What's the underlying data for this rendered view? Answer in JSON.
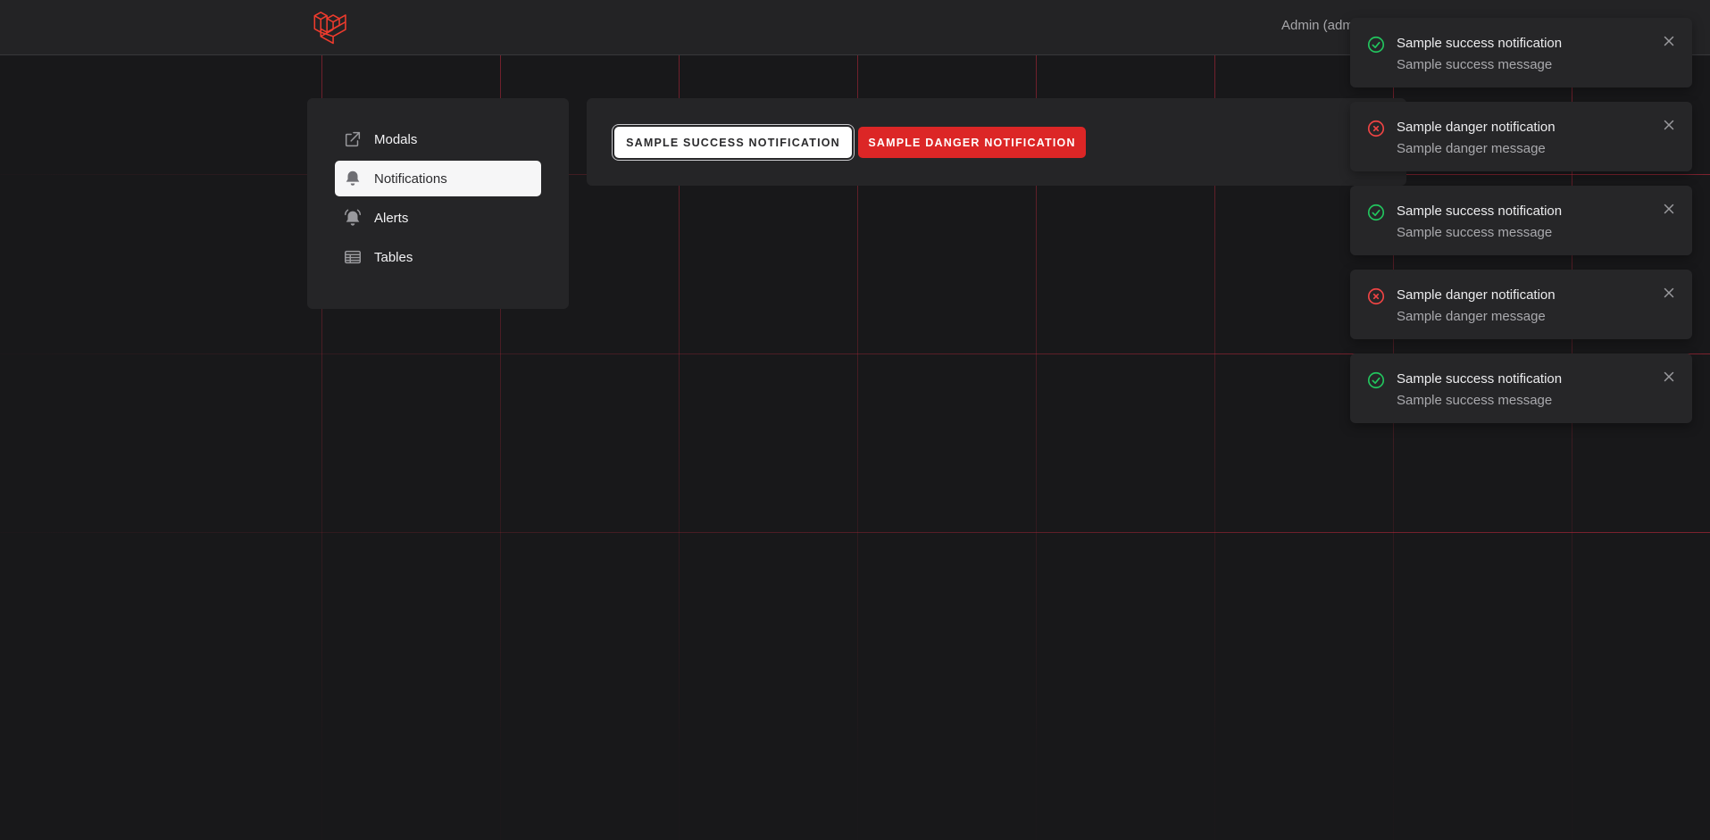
{
  "header": {
    "logo_icon": "laravel-logo-icon",
    "user_label": "Admin (admin@example.com)"
  },
  "sidebar": {
    "items": [
      {
        "label": "Modals",
        "icon": "external-link-icon",
        "active": false
      },
      {
        "label": "Notifications",
        "icon": "bell-icon",
        "active": true
      },
      {
        "label": "Alerts",
        "icon": "bell-alert-icon",
        "active": false
      },
      {
        "label": "Tables",
        "icon": "table-icon",
        "active": false
      }
    ]
  },
  "main": {
    "success_button_label": "SAMPLE SUCCESS NOTIFICATION",
    "danger_button_label": "SAMPLE DANGER NOTIFICATION"
  },
  "toasts": [
    {
      "type": "success",
      "title": "Sample success notification",
      "message": "Sample success message"
    },
    {
      "type": "danger",
      "title": "Sample danger notification",
      "message": "Sample danger message"
    },
    {
      "type": "success",
      "title": "Sample success notification",
      "message": "Sample success message"
    },
    {
      "type": "danger",
      "title": "Sample danger notification",
      "message": "Sample danger message"
    },
    {
      "type": "success",
      "title": "Sample success notification",
      "message": "Sample success message"
    }
  ],
  "colors": {
    "accent": "#dc2626",
    "success": "#22c55e",
    "danger": "#ef4444",
    "background": "#18181a",
    "panel": "#252527"
  }
}
